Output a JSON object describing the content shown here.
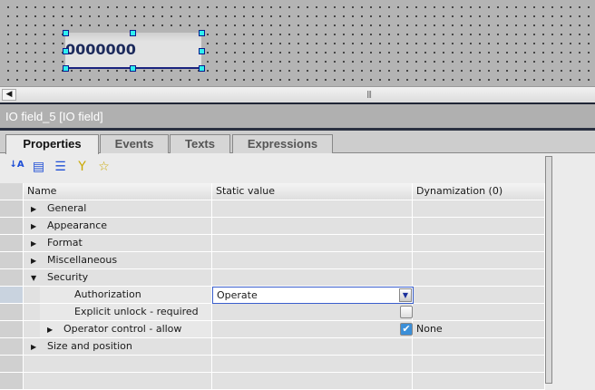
{
  "canvas": {
    "io_field_value": "0000000"
  },
  "inspector": {
    "title": "IO field_5 [IO field]"
  },
  "tabs": [
    "Properties",
    "Events",
    "Texts",
    "Expressions"
  ],
  "active_tab": "Properties",
  "toolbar": {
    "icons": [
      "sort-az-icon",
      "categories-icon",
      "list-icon",
      "filter-icon",
      "favorites-icon"
    ]
  },
  "table": {
    "headers": {
      "name": "Name",
      "static": "Static value",
      "dyn": "Dynamization (0)"
    },
    "rows": [
      {
        "name": "General",
        "expander": "collapsed"
      },
      {
        "name": "Appearance",
        "expander": "collapsed"
      },
      {
        "name": "Format",
        "expander": "collapsed"
      },
      {
        "name": "Miscellaneous",
        "expander": "collapsed"
      },
      {
        "name": "Security",
        "expander": "expanded"
      },
      {
        "name": "Authorization",
        "value": "Operate"
      },
      {
        "name": "Explicit unlock - required",
        "checked": false
      },
      {
        "name": "Operator control - allow",
        "expander": "collapsed",
        "checked": true,
        "dyn": "None"
      },
      {
        "name": "Size and position",
        "expander": "collapsed"
      }
    ]
  }
}
